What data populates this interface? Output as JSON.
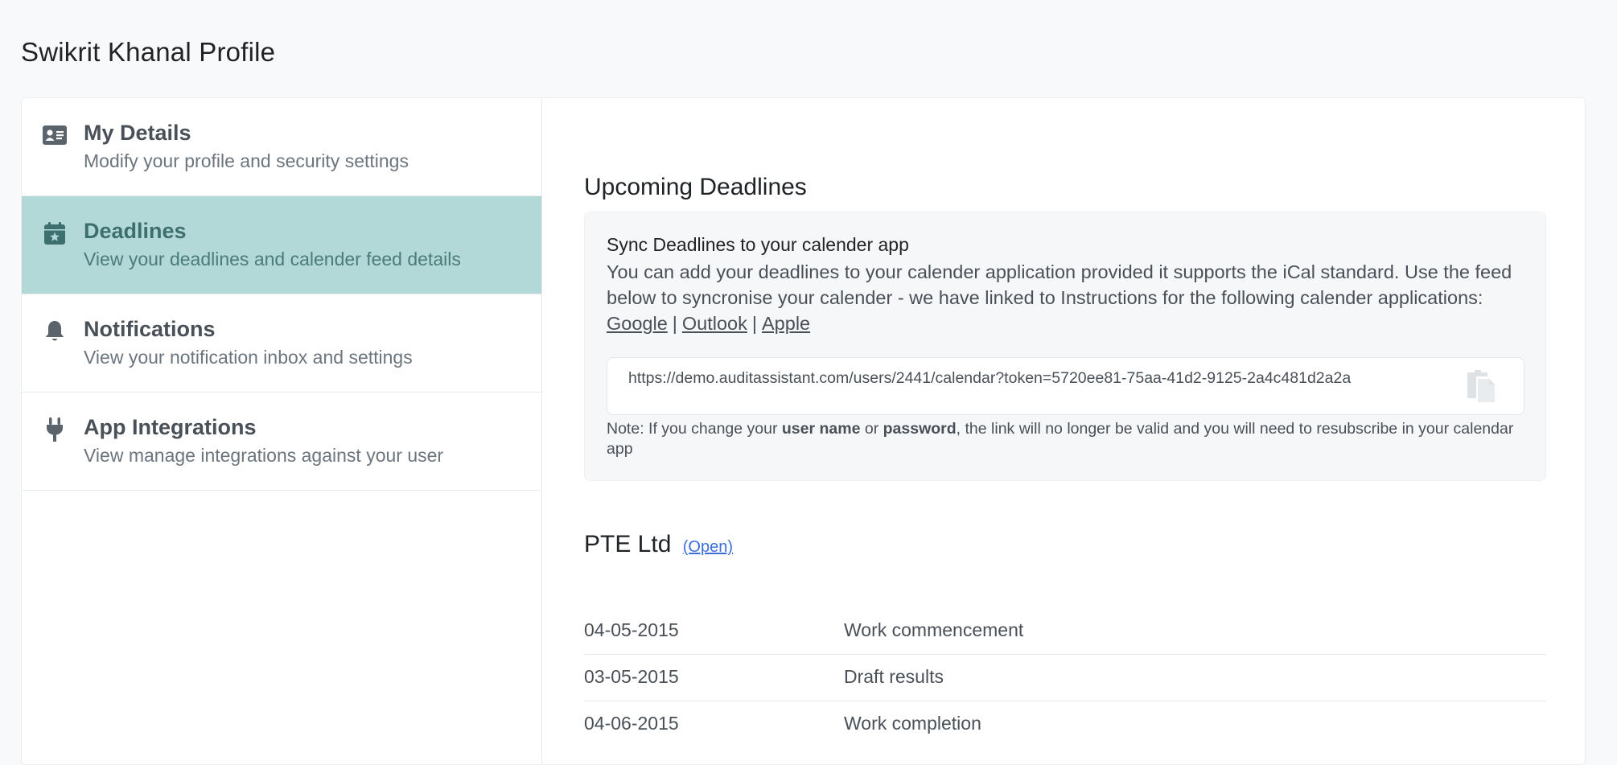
{
  "page": {
    "title": "Swikrit Khanal Profile"
  },
  "sidebar": {
    "items": [
      {
        "title": "My Details",
        "subtitle": "Modify your profile and security settings",
        "icon": "id-card-icon",
        "active": false
      },
      {
        "title": "Deadlines",
        "subtitle": "View your deadlines and calender feed details",
        "icon": "calendar-star-icon",
        "active": true
      },
      {
        "title": "Notifications",
        "subtitle": "View your notification inbox and settings",
        "icon": "bell-icon",
        "active": false
      },
      {
        "title": "App Integrations",
        "subtitle": "View manage integrations against your user",
        "icon": "plug-icon",
        "active": false
      }
    ],
    "active_bg": "#b2d9d8"
  },
  "main": {
    "heading": "Upcoming Deadlines",
    "sync": {
      "title": "Sync Deadlines to your calender app",
      "description": "You can add your deadlines to your calender application provided it supports the iCal standard. Use the feed below to syncronise your calender - we have linked to Instructions for the following calender applications:",
      "links": {
        "google": "Google",
        "outlook": "Outlook",
        "apple": "Apple",
        "separator": "|"
      },
      "feed_url": "https://demo.auditassistant.com/users/2441/calendar?token=5720ee81-75aa-41d2-9125-2a4c481d2a2a",
      "copy_icon": "copy-icon",
      "note": {
        "prefix": "Note: If you change your ",
        "bold1": "user name",
        "mid": " or ",
        "bold2": "password",
        "suffix": ", the link will no longer be valid and you will need to resubscribe in your calendar app"
      }
    },
    "client": {
      "name": "PTE Ltd",
      "status_link": "(Open)",
      "deadlines": [
        {
          "date": "04-05-2015",
          "label": "Work commencement"
        },
        {
          "date": "03-05-2015",
          "label": "Draft results"
        },
        {
          "date": "04-06-2015",
          "label": "Work completion"
        }
      ]
    }
  }
}
